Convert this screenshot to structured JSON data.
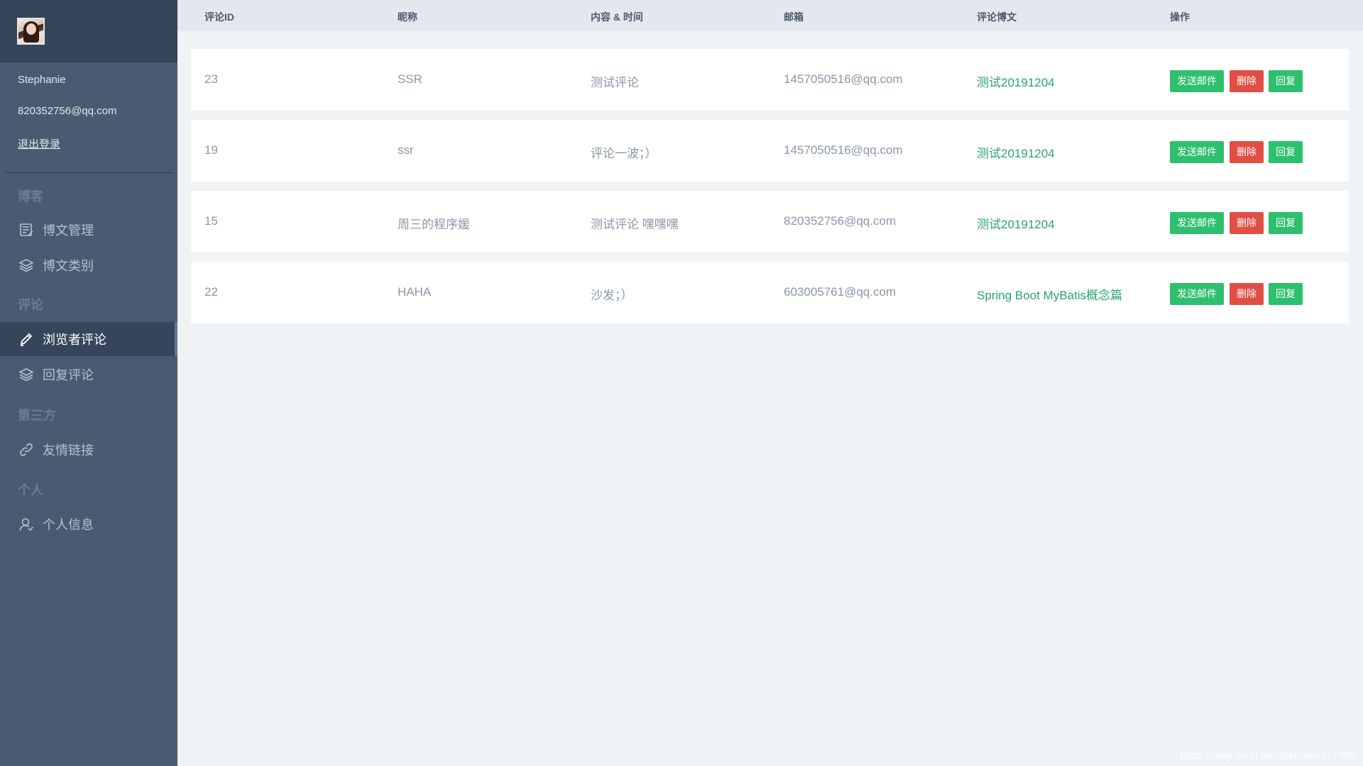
{
  "sidebar": {
    "user_name": "Stephanie",
    "user_email": "820352756@qq.com",
    "logout_label": "退出登录",
    "sections": {
      "blog": "博客",
      "comments": "评论",
      "third_party": "第三方",
      "personal": "个人"
    },
    "items": {
      "post_manage": {
        "label": "博文管理",
        "icon": "document-icon"
      },
      "post_category": {
        "label": "博文类别",
        "icon": "layers-icon"
      },
      "visitor_comments": {
        "label": "浏览者评论",
        "icon": "pencil-icon"
      },
      "reply_comments": {
        "label": "回复评论",
        "icon": "layers-icon"
      },
      "friend_links": {
        "label": "友情链接",
        "icon": "link-icon"
      },
      "profile": {
        "label": "个人信息",
        "icon": "user-icon"
      }
    }
  },
  "table": {
    "headers": {
      "id": "评论ID",
      "nickname": "昵称",
      "content": "内容 & 时间",
      "email": "邮箱",
      "post": "评论博文",
      "actions": "操作"
    },
    "rows": [
      {
        "id": "23",
        "nickname": "SSR",
        "content": "测试评论",
        "email": "1457050516@qq.com",
        "post": "测试20191204"
      },
      {
        "id": "19",
        "nickname": "ssr",
        "content": "评论一波；）",
        "email": "1457050516@qq.com",
        "post": "测试20191204"
      },
      {
        "id": "15",
        "nickname": "周三的程序媛",
        "content": "测试评论 嘿嘿嘿",
        "email": "820352756@qq.com",
        "post": "测试20191204"
      },
      {
        "id": "22",
        "nickname": "HAHA",
        "content": "沙发；）",
        "email": "603005761@qq.com",
        "post": "Spring Boot MyBatis概念篇"
      }
    ],
    "buttons": {
      "send_mail": "发送邮件",
      "delete": "删除",
      "reply": "回复"
    }
  },
  "watermark": "https://blog.csdn.net/Stephanie17395",
  "colors": {
    "sidebar_bg": "#4a5a70",
    "sidebar_dark": "#36455a",
    "link_green": "#28a56b",
    "btn_green": "#2ebf6f",
    "btn_red": "#e04e45"
  }
}
